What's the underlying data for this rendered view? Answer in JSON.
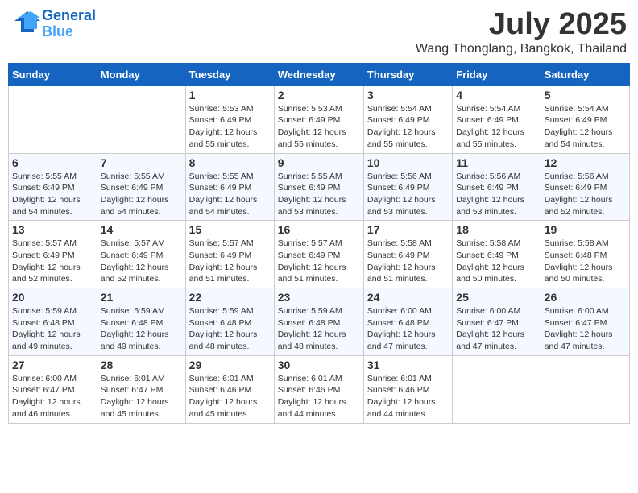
{
  "header": {
    "logo_line1": "General",
    "logo_line2": "Blue",
    "month": "July 2025",
    "location": "Wang Thonglang, Bangkok, Thailand"
  },
  "days": [
    "Sunday",
    "Monday",
    "Tuesday",
    "Wednesday",
    "Thursday",
    "Friday",
    "Saturday"
  ],
  "weeks": [
    [
      {
        "date": "",
        "sunrise": "",
        "sunset": "",
        "daylight": ""
      },
      {
        "date": "",
        "sunrise": "",
        "sunset": "",
        "daylight": ""
      },
      {
        "date": "1",
        "sunrise": "Sunrise: 5:53 AM",
        "sunset": "Sunset: 6:49 PM",
        "daylight": "Daylight: 12 hours and 55 minutes."
      },
      {
        "date": "2",
        "sunrise": "Sunrise: 5:53 AM",
        "sunset": "Sunset: 6:49 PM",
        "daylight": "Daylight: 12 hours and 55 minutes."
      },
      {
        "date": "3",
        "sunrise": "Sunrise: 5:54 AM",
        "sunset": "Sunset: 6:49 PM",
        "daylight": "Daylight: 12 hours and 55 minutes."
      },
      {
        "date": "4",
        "sunrise": "Sunrise: 5:54 AM",
        "sunset": "Sunset: 6:49 PM",
        "daylight": "Daylight: 12 hours and 55 minutes."
      },
      {
        "date": "5",
        "sunrise": "Sunrise: 5:54 AM",
        "sunset": "Sunset: 6:49 PM",
        "daylight": "Daylight: 12 hours and 54 minutes."
      }
    ],
    [
      {
        "date": "6",
        "sunrise": "Sunrise: 5:55 AM",
        "sunset": "Sunset: 6:49 PM",
        "daylight": "Daylight: 12 hours and 54 minutes."
      },
      {
        "date": "7",
        "sunrise": "Sunrise: 5:55 AM",
        "sunset": "Sunset: 6:49 PM",
        "daylight": "Daylight: 12 hours and 54 minutes."
      },
      {
        "date": "8",
        "sunrise": "Sunrise: 5:55 AM",
        "sunset": "Sunset: 6:49 PM",
        "daylight": "Daylight: 12 hours and 54 minutes."
      },
      {
        "date": "9",
        "sunrise": "Sunrise: 5:55 AM",
        "sunset": "Sunset: 6:49 PM",
        "daylight": "Daylight: 12 hours and 53 minutes."
      },
      {
        "date": "10",
        "sunrise": "Sunrise: 5:56 AM",
        "sunset": "Sunset: 6:49 PM",
        "daylight": "Daylight: 12 hours and 53 minutes."
      },
      {
        "date": "11",
        "sunrise": "Sunrise: 5:56 AM",
        "sunset": "Sunset: 6:49 PM",
        "daylight": "Daylight: 12 hours and 53 minutes."
      },
      {
        "date": "12",
        "sunrise": "Sunrise: 5:56 AM",
        "sunset": "Sunset: 6:49 PM",
        "daylight": "Daylight: 12 hours and 52 minutes."
      }
    ],
    [
      {
        "date": "13",
        "sunrise": "Sunrise: 5:57 AM",
        "sunset": "Sunset: 6:49 PM",
        "daylight": "Daylight: 12 hours and 52 minutes."
      },
      {
        "date": "14",
        "sunrise": "Sunrise: 5:57 AM",
        "sunset": "Sunset: 6:49 PM",
        "daylight": "Daylight: 12 hours and 52 minutes."
      },
      {
        "date": "15",
        "sunrise": "Sunrise: 5:57 AM",
        "sunset": "Sunset: 6:49 PM",
        "daylight": "Daylight: 12 hours and 51 minutes."
      },
      {
        "date": "16",
        "sunrise": "Sunrise: 5:57 AM",
        "sunset": "Sunset: 6:49 PM",
        "daylight": "Daylight: 12 hours and 51 minutes."
      },
      {
        "date": "17",
        "sunrise": "Sunrise: 5:58 AM",
        "sunset": "Sunset: 6:49 PM",
        "daylight": "Daylight: 12 hours and 51 minutes."
      },
      {
        "date": "18",
        "sunrise": "Sunrise: 5:58 AM",
        "sunset": "Sunset: 6:49 PM",
        "daylight": "Daylight: 12 hours and 50 minutes."
      },
      {
        "date": "19",
        "sunrise": "Sunrise: 5:58 AM",
        "sunset": "Sunset: 6:48 PM",
        "daylight": "Daylight: 12 hours and 50 minutes."
      }
    ],
    [
      {
        "date": "20",
        "sunrise": "Sunrise: 5:59 AM",
        "sunset": "Sunset: 6:48 PM",
        "daylight": "Daylight: 12 hours and 49 minutes."
      },
      {
        "date": "21",
        "sunrise": "Sunrise: 5:59 AM",
        "sunset": "Sunset: 6:48 PM",
        "daylight": "Daylight: 12 hours and 49 minutes."
      },
      {
        "date": "22",
        "sunrise": "Sunrise: 5:59 AM",
        "sunset": "Sunset: 6:48 PM",
        "daylight": "Daylight: 12 hours and 48 minutes."
      },
      {
        "date": "23",
        "sunrise": "Sunrise: 5:59 AM",
        "sunset": "Sunset: 6:48 PM",
        "daylight": "Daylight: 12 hours and 48 minutes."
      },
      {
        "date": "24",
        "sunrise": "Sunrise: 6:00 AM",
        "sunset": "Sunset: 6:48 PM",
        "daylight": "Daylight: 12 hours and 47 minutes."
      },
      {
        "date": "25",
        "sunrise": "Sunrise: 6:00 AM",
        "sunset": "Sunset: 6:47 PM",
        "daylight": "Daylight: 12 hours and 47 minutes."
      },
      {
        "date": "26",
        "sunrise": "Sunrise: 6:00 AM",
        "sunset": "Sunset: 6:47 PM",
        "daylight": "Daylight: 12 hours and 47 minutes."
      }
    ],
    [
      {
        "date": "27",
        "sunrise": "Sunrise: 6:00 AM",
        "sunset": "Sunset: 6:47 PM",
        "daylight": "Daylight: 12 hours and 46 minutes."
      },
      {
        "date": "28",
        "sunrise": "Sunrise: 6:01 AM",
        "sunset": "Sunset: 6:47 PM",
        "daylight": "Daylight: 12 hours and 45 minutes."
      },
      {
        "date": "29",
        "sunrise": "Sunrise: 6:01 AM",
        "sunset": "Sunset: 6:46 PM",
        "daylight": "Daylight: 12 hours and 45 minutes."
      },
      {
        "date": "30",
        "sunrise": "Sunrise: 6:01 AM",
        "sunset": "Sunset: 6:46 PM",
        "daylight": "Daylight: 12 hours and 44 minutes."
      },
      {
        "date": "31",
        "sunrise": "Sunrise: 6:01 AM",
        "sunset": "Sunset: 6:46 PM",
        "daylight": "Daylight: 12 hours and 44 minutes."
      },
      {
        "date": "",
        "sunrise": "",
        "sunset": "",
        "daylight": ""
      },
      {
        "date": "",
        "sunrise": "",
        "sunset": "",
        "daylight": ""
      }
    ]
  ]
}
